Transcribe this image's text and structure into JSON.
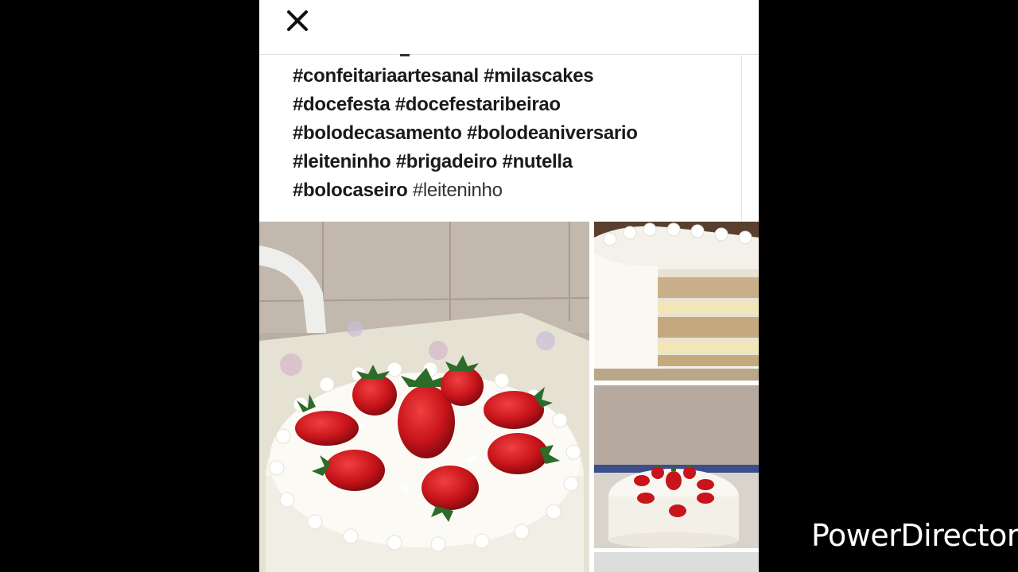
{
  "header": {
    "close_icon": "close-icon"
  },
  "caption": {
    "lines": [
      "#confeitariaartesanal #milascakes",
      "#docefesta #docefestaribeirao",
      "#bolodecasamento #bolodeaniversario",
      "#leiteninho #brigadeiro #nutella"
    ],
    "last_bold": "#bolocaseiro",
    "last_light": "#leiteninho"
  },
  "gallery": {
    "photos": [
      {
        "name": "main-cake-photo",
        "subject": "white cake with strawberries"
      },
      {
        "name": "cake-slice-photo",
        "subject": "sliced cake interior"
      },
      {
        "name": "cake-strawberry-photo",
        "subject": "cake with strawberries on table"
      }
    ]
  },
  "watermark": {
    "text": "PowerDirector"
  },
  "colors": {
    "background": "#000000",
    "panel": "#ffffff",
    "text": "#1a1a1a",
    "strawberry": "#c8141a",
    "cream": "#f7f5ee"
  }
}
